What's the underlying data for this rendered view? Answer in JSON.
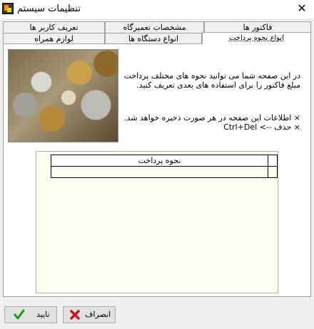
{
  "window": {
    "title": "تنظیمات سیستم",
    "close_glyph": "✕"
  },
  "tabs_row1": [
    {
      "label": "فاکتور ها"
    },
    {
      "label": "مشخصات تعمیرگاه"
    },
    {
      "label": "تعریف کاربر ها"
    }
  ],
  "tabs_row2": [
    {
      "label": "انواع نحوه پرداخت",
      "active": true
    },
    {
      "label": "انواع دستگاه ها"
    },
    {
      "label": "لوازم همراه"
    }
  ],
  "content": {
    "description": "در این صفحه شما می توانید نحوه های مختلف پرداخت مبلغ فاکتور را برای استفاده های بعدی تعریف کنید.",
    "note1": "× اطلاعات این صفحه در هر صورت ذخیره خواهد شد.",
    "note2": "× حذف --> Ctrl+Del",
    "image_icon": "coins-image"
  },
  "grid": {
    "header": "نحوه پرداخت",
    "rows": [
      ""
    ]
  },
  "buttons": {
    "ok_label": "تایید",
    "cancel_label": "انصراف",
    "ok_icon": "check-icon",
    "cancel_icon": "x-icon",
    "ok_color": "#1a9a1a",
    "cancel_color": "#c8141e"
  }
}
